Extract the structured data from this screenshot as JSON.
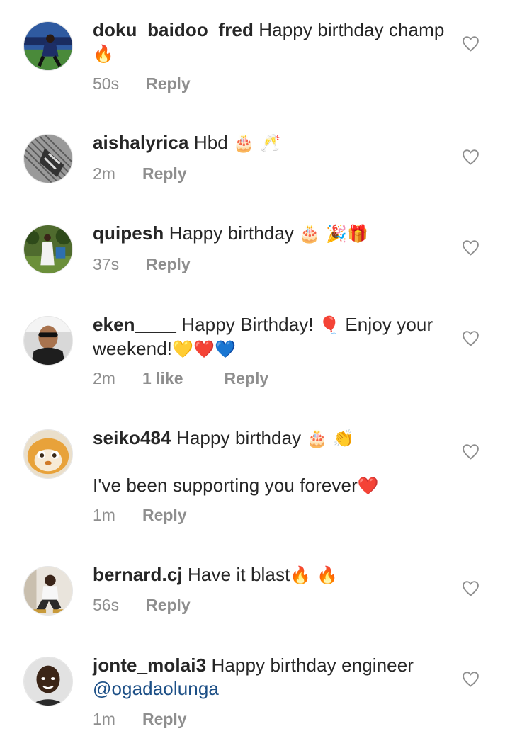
{
  "comments": [
    {
      "username": "doku_baidoo_fred",
      "text": "Happy birthday champ",
      "emoji": "🔥",
      "time": "50s",
      "likes": "",
      "reply": "Reply"
    },
    {
      "username": "aishalyrica",
      "text": "Hbd",
      "emoji": "🎂 🥂",
      "time": "2m",
      "likes": "",
      "reply": "Reply"
    },
    {
      "username": "quipesh",
      "text": "Happy birthday",
      "emoji": "🎂 🎉🎁",
      "time": "37s",
      "likes": "",
      "reply": "Reply"
    },
    {
      "username": "eken____",
      "text": "Happy Birthday!",
      "emoji": "🎈",
      "text2": "Enjoy your weekend!",
      "emoji2": "💛❤️💙",
      "time": "2m",
      "likes": "1 like",
      "reply": "Reply"
    },
    {
      "username": "seiko484",
      "text": "Happy birthday",
      "emoji": "🎂 👏",
      "text2": "I've been supporting you forever",
      "emoji2": "❤️",
      "time": "1m",
      "likes": "",
      "reply": "Reply"
    },
    {
      "username": "bernard.cj",
      "text": "Have it blast",
      "emoji": "🔥 🔥",
      "time": "56s",
      "likes": "",
      "reply": "Reply"
    },
    {
      "username": "jonte_molai3",
      "text": "Happy birthday engineer",
      "mention": "@ogadaolunga",
      "time": "1m",
      "likes": "",
      "reply": "Reply"
    }
  ],
  "icons": {
    "like": "heart-outline-icon"
  },
  "colors": {
    "text": "#262626",
    "meta": "#8e8e8e",
    "mention": "#1c4f86"
  }
}
